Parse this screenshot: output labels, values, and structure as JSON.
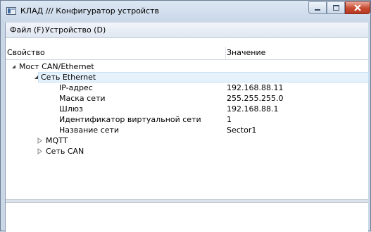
{
  "window": {
    "title": "КЛАД /// Конфигуратор устройств"
  },
  "menu": {
    "items": [
      "Файл (F)",
      "Устройство (D)"
    ]
  },
  "tree": {
    "columns": {
      "property": "Свойство",
      "value": "Значение"
    },
    "rows": [
      {
        "name": "Мост CAN/Ethernet",
        "value": "",
        "level": 0,
        "state": "expanded"
      },
      {
        "name": "Сеть Ethernet",
        "value": "",
        "level": 1,
        "state": "expanded",
        "selected": true
      },
      {
        "name": "IP-адрес",
        "value": "192.168.88.11",
        "level": 2,
        "state": "leaf"
      },
      {
        "name": "Маска сети",
        "value": "255.255.255.0",
        "level": 2,
        "state": "leaf"
      },
      {
        "name": "Шлюз",
        "value": "192.168.88.1",
        "level": 2,
        "state": "leaf"
      },
      {
        "name": "Идентификатор виртуальной сети",
        "value": "1",
        "level": 2,
        "state": "leaf"
      },
      {
        "name": "Название сети",
        "value": "Sector1",
        "level": 2,
        "state": "leaf"
      },
      {
        "name": "MQTT",
        "value": "",
        "level": 1,
        "state": "collapsed"
      },
      {
        "name": "Сеть CAN",
        "value": "",
        "level": 1,
        "state": "collapsed"
      }
    ]
  }
}
